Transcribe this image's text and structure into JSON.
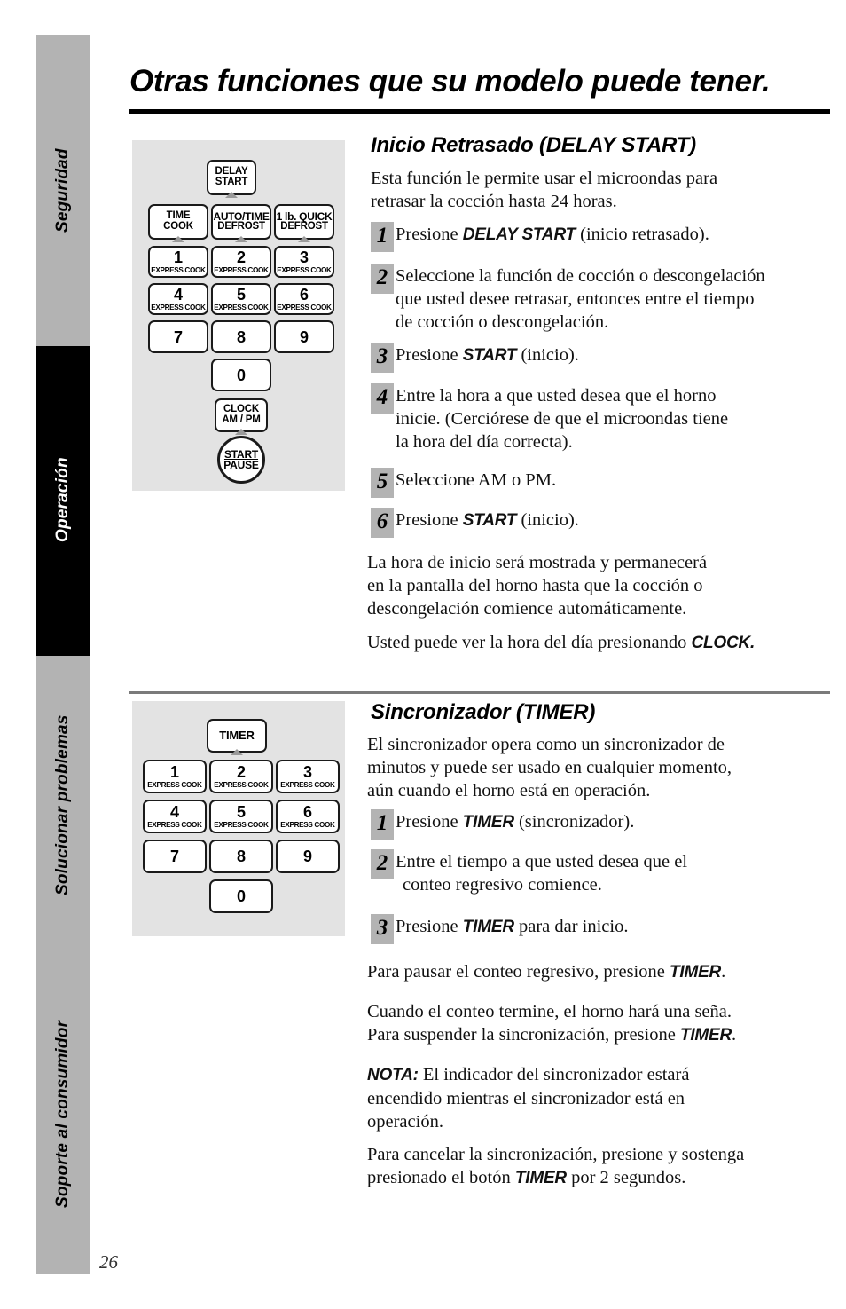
{
  "page": {
    "title": "Otras funciones que su modelo puede tener.",
    "number": "26"
  },
  "sidebar": {
    "tabs": [
      {
        "label": "Seguridad",
        "active": false
      },
      {
        "label": "Operación",
        "active": true
      },
      {
        "label": "Solucionar problemas",
        "active": false
      },
      {
        "label": "Soporte al consumidor",
        "active": false
      }
    ]
  },
  "keypad_delay": {
    "delay_start": {
      "line1": "DELAY",
      "line2": "START"
    },
    "time_cook": {
      "line1": "TIME",
      "line2": "COOK"
    },
    "auto_defrost": {
      "line1": "AUTO/TIME",
      "line2": "DEFROST"
    },
    "quick_defrost": {
      "line1": "1 lb. QUICK",
      "line2": "DEFROST"
    },
    "numbers": [
      {
        "num": "1",
        "sub": "EXPRESS COOK"
      },
      {
        "num": "2",
        "sub": "EXPRESS COOK"
      },
      {
        "num": "3",
        "sub": "EXPRESS COOK"
      },
      {
        "num": "4",
        "sub": "EXPRESS COOK"
      },
      {
        "num": "5",
        "sub": "EXPRESS COOK"
      },
      {
        "num": "6",
        "sub": "EXPRESS COOK"
      },
      {
        "num": "7",
        "sub": ""
      },
      {
        "num": "8",
        "sub": ""
      },
      {
        "num": "9",
        "sub": ""
      },
      {
        "num": "0",
        "sub": ""
      }
    ],
    "clock": {
      "line1": "CLOCK",
      "line2": "AM / PM"
    },
    "start_pause": {
      "line1": "START",
      "line2": "PAUSE"
    }
  },
  "keypad_timer": {
    "timer": {
      "line1": "TIMER"
    },
    "numbers": [
      {
        "num": "1",
        "sub": "EXPRESS COOK"
      },
      {
        "num": "2",
        "sub": "EXPRESS COOK"
      },
      {
        "num": "3",
        "sub": "EXPRESS COOK"
      },
      {
        "num": "4",
        "sub": "EXPRESS COOK"
      },
      {
        "num": "5",
        "sub": "EXPRESS COOK"
      },
      {
        "num": "6",
        "sub": "EXPRESS COOK"
      },
      {
        "num": "7",
        "sub": ""
      },
      {
        "num": "8",
        "sub": ""
      },
      {
        "num": "9",
        "sub": ""
      },
      {
        "num": "0",
        "sub": ""
      }
    ]
  },
  "section_delay": {
    "heading": "Inicio Retrasado (DELAY START)",
    "intro_l1": "Esta función le permite usar el microondas para",
    "intro_l2": "retrasar la cocción hasta 24 horas.",
    "steps": [
      {
        "n": "1",
        "l1": "Presione ",
        "bold": "DELAY START",
        "l2": " (inicio retrasado)."
      },
      {
        "n": "2",
        "l1": "Seleccione la función de cocción o descongelación",
        "l2": "que usted desee retrasar, entonces entre el tiempo",
        "l3": "de cocción o descongelación."
      },
      {
        "n": "3",
        "l1": "Presione ",
        "bold": "START",
        "l2": " (inicio)."
      },
      {
        "n": "4",
        "l1": "Entre la hora a que usted desea que el horno",
        "l2": "inicie. (Cerciórese de que el microondas tiene",
        "l3": "la hora del día correcta)."
      },
      {
        "n": "5",
        "l1": "Seleccione AM o PM."
      },
      {
        "n": "6",
        "l1": "Presione ",
        "bold": "START",
        "l2": " (inicio)."
      }
    ],
    "outro1_l1": "La hora de inicio será mostrada y permanecerá",
    "outro1_l2": "en la pantalla del horno hasta que la cocción o",
    "outro1_l3": "descongelación comience automáticamente.",
    "outro2_pre": "Usted puede ver la hora del día presionando ",
    "outro2_bold": "CLOCK.",
    "outro2_post": ""
  },
  "section_timer": {
    "heading": "Sincronizador (TIMER)",
    "intro_l1": "El sincronizador opera como un sincronizador de",
    "intro_l2": "minutos y puede ser usado en cualquier momento,",
    "intro_l3": "aún cuando el horno está en operación.",
    "steps": [
      {
        "n": "1",
        "l1": "Presione ",
        "bold": "TIMER",
        "l2": " (sincronizador)."
      },
      {
        "n": "2",
        "l1": "Entre el tiempo a que usted desea que el",
        "l2": "conteo regresivo comience."
      },
      {
        "n": "3",
        "l1": "Presione ",
        "bold": "TIMER",
        "l2": " para dar inicio."
      }
    ],
    "p1_pre": "Para pausar el conteo regresivo, presione ",
    "p1_bold": "TIMER",
    "p1_post": ".",
    "p2_l1": "Cuando el conteo termine, el horno hará una seña.",
    "p2_l2_pre": "Para suspender la sincronización, presione ",
    "p2_bold": "TIMER",
    "p2_post": ".",
    "note_label": "NOTA:",
    "note_l1": " El indicador del sincronizador estará",
    "note_l2": "encendido mientras el sincronizador está en",
    "note_l3": "operación.",
    "p3_l1": "Para cancelar la sincronización, presione y sostenga",
    "p3_l2_pre": "presionado el botón ",
    "p3_bold": "TIMER",
    "p3_post": " por 2 segundos."
  }
}
